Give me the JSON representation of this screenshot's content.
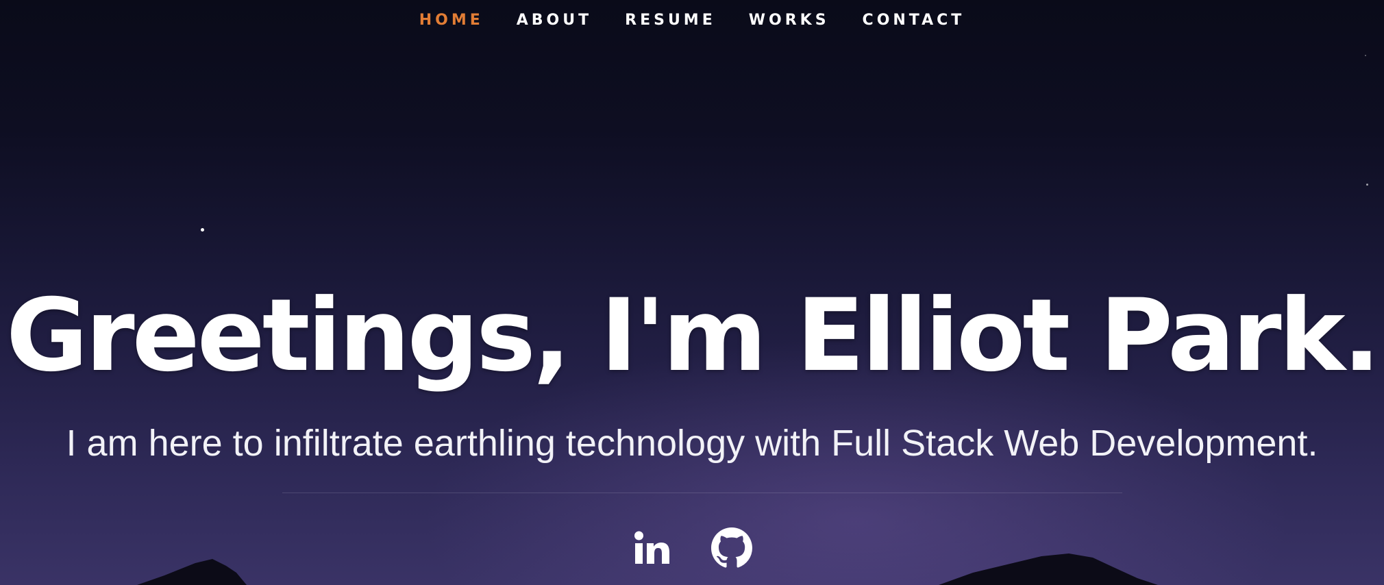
{
  "nav": {
    "items": [
      {
        "label": "HOME",
        "active": true
      },
      {
        "label": "ABOUT",
        "active": false
      },
      {
        "label": "RESUME",
        "active": false
      },
      {
        "label": "WORKS",
        "active": false
      },
      {
        "label": "CONTACT",
        "active": false
      }
    ],
    "active_color": "#e27d35",
    "text_color": "#ffffff"
  },
  "hero": {
    "headline": "Greetings, I'm Elliot Park.",
    "tagline": "I am here to infiltrate earthling technology with Full Stack Web Development."
  },
  "social": {
    "links": [
      {
        "icon": "linkedin-icon",
        "label": "LinkedIn"
      },
      {
        "icon": "github-icon",
        "label": "GitHub"
      }
    ]
  }
}
